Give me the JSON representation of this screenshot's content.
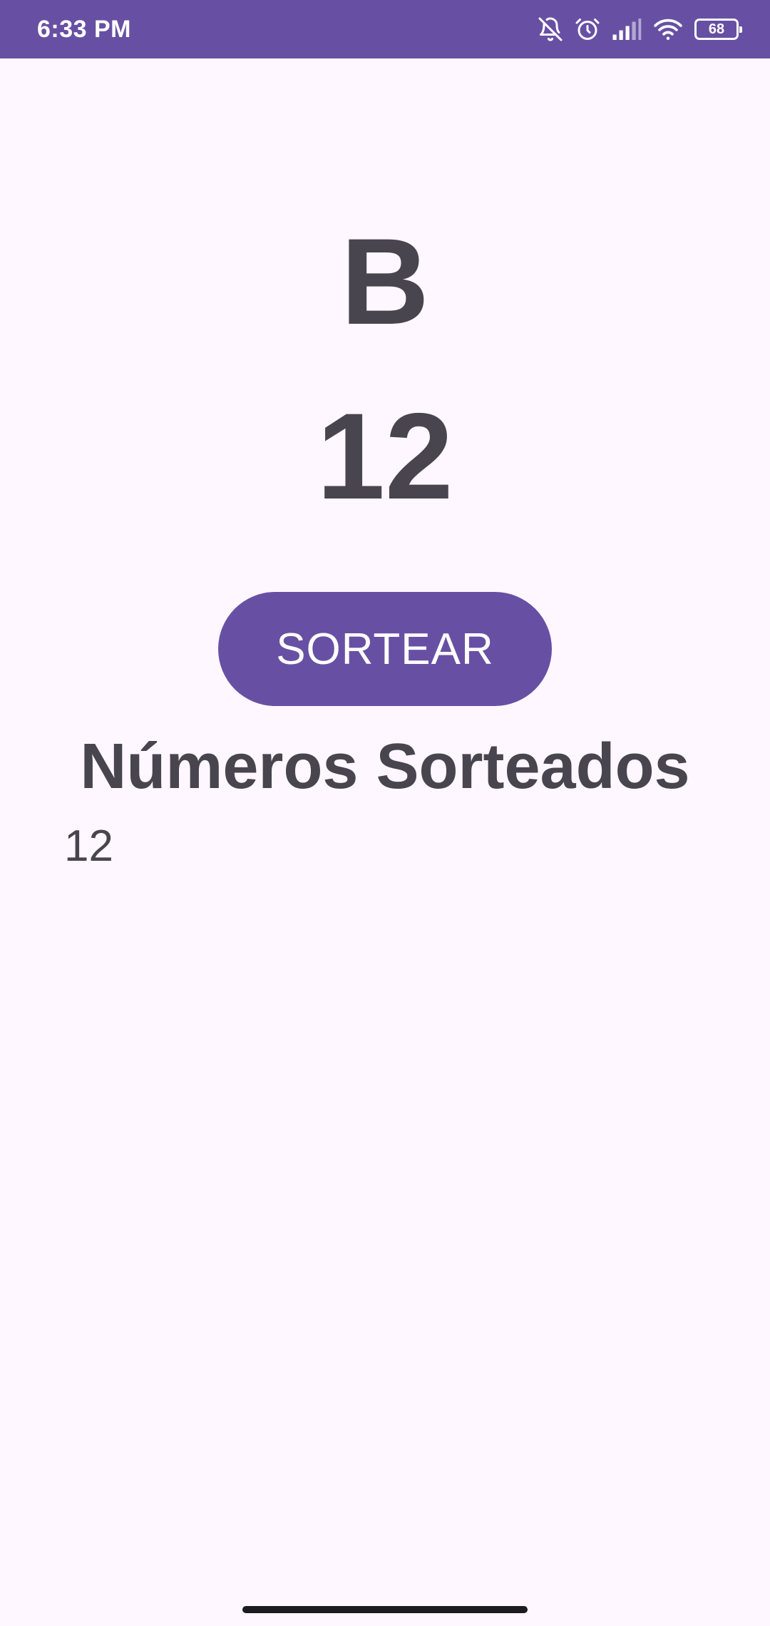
{
  "status_bar": {
    "time": "6:33 PM",
    "battery": "68",
    "icons": [
      "bell-off-icon",
      "alarm-icon",
      "signal-icon",
      "wifi-icon",
      "battery-icon"
    ],
    "background_color": "#6750A4"
  },
  "draw": {
    "letter": "B",
    "number": "12"
  },
  "draw_button": {
    "label": "SORTEAR",
    "color": "#6750A4"
  },
  "drawn_numbers": {
    "title": "Números Sorteados",
    "items": [
      "12"
    ]
  },
  "colors": {
    "background": "#FEF7FF",
    "text": "#49454F"
  }
}
